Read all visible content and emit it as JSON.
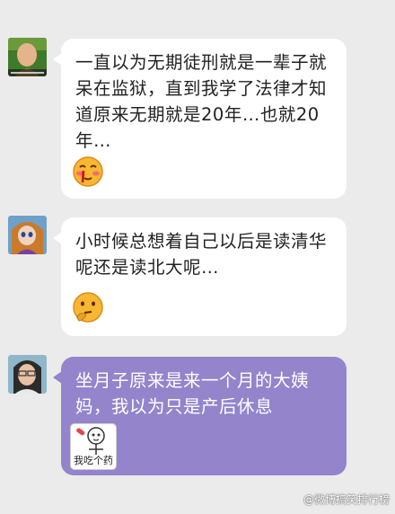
{
  "messages": [
    {
      "text": "一直以为无期徒刑就是一辈子就呆在监狱，直到我学了法律才知道原来无期就是20年…也就20年…",
      "avatar_icon": "monk-avatar-icon",
      "emoji_icon": "blushing-bleeding-emoji-icon"
    },
    {
      "text": "小时候总想着自己以后是读清华呢还是读北大呢…",
      "avatar_icon": "cartoon-girl-avatar-icon",
      "emoji_icon": "thinking-emoji-icon"
    },
    {
      "text": "坐月子原来是来一个月的大姨妈，我以为只是产后休息",
      "avatar_icon": "woman-avatar-icon",
      "sticker_text": "我吃个药"
    }
  ],
  "watermark": "@微博搞笑排行榜",
  "colors": {
    "background": "#ebebeb",
    "bubble_white": "#ffffff",
    "bubble_purple": "#9384cc"
  }
}
